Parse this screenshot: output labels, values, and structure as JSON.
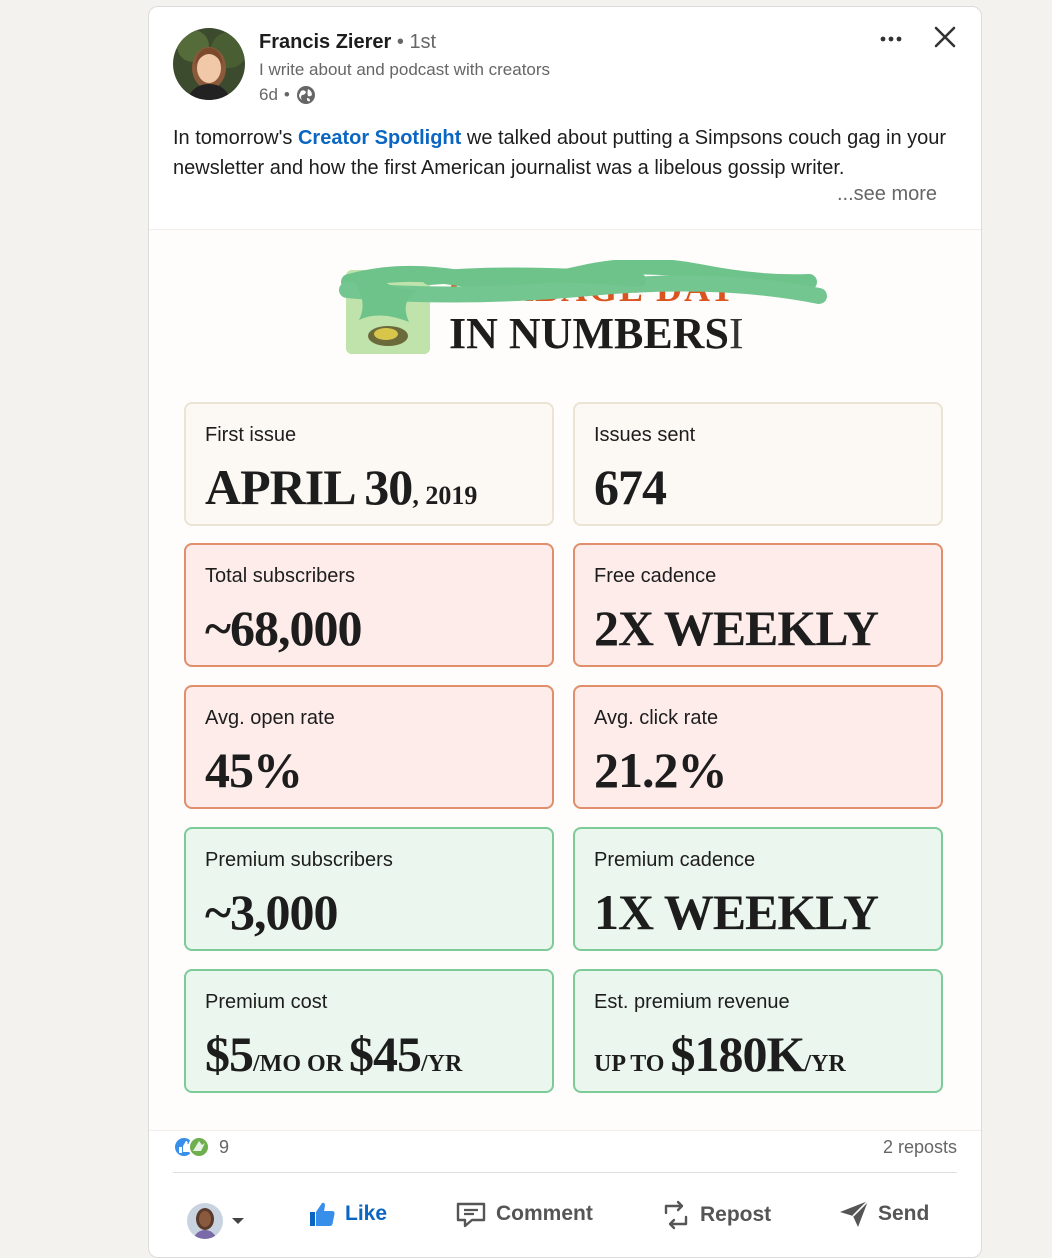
{
  "post": {
    "author": {
      "name": "Francis Zierer",
      "degree_sep": "•",
      "degree": "1st",
      "headline": "I write about and podcast with creators",
      "age": "6d",
      "age_sep": "•"
    },
    "text_before": "In tomorrow's ",
    "text_link": "Creator Spotlight",
    "text_after": " we talked about putting a Simpsons couch gag in your newsletter and how the first American journalist was a libelous gossip writer.",
    "see_more": "...see more",
    "icons": {
      "more": "more-options-icon",
      "close": "close-icon",
      "visibility": "globe-icon"
    }
  },
  "image": {
    "brand_redacted": "GARBAGE DAY",
    "title": "IN NUMBERS",
    "cursor_glyph": "I",
    "colors": {
      "cream": "#fcf9f4",
      "pink": "#fdecea",
      "green": "#ebf6ee",
      "accent_orange": "#d9541e",
      "scribble": "#6ec38a"
    },
    "stats": [
      {
        "label": "First issue",
        "value": "APRIL 30",
        "value_suffix": ", 2019"
      },
      {
        "label": "Issues sent",
        "value": "674"
      },
      {
        "label": "Total subscribers",
        "value": "~68,000"
      },
      {
        "label": "Free cadence",
        "value": "2X WEEKLY"
      },
      {
        "label": "Avg. open rate",
        "value": "45%"
      },
      {
        "label": "Avg. click rate",
        "value": "21.2%"
      },
      {
        "label": "Premium subscribers",
        "value": "~3,000"
      },
      {
        "label": "Premium cadence",
        "value": "1X WEEKLY"
      },
      {
        "label": "Premium cost",
        "value_a": "$5",
        "unit_a": "/MO",
        "or": " OR ",
        "value_b": "$45",
        "unit_b": "/YR"
      },
      {
        "label": "Est. premium revenue",
        "prefix": "UP TO ",
        "value": "$180K",
        "unit": "/YR"
      }
    ]
  },
  "social": {
    "reaction_count": "9",
    "reposts": "2 reposts"
  },
  "actions": {
    "like": "Like",
    "comment": "Comment",
    "repost": "Repost",
    "send": "Send"
  },
  "accent_color": "#0a66c2"
}
